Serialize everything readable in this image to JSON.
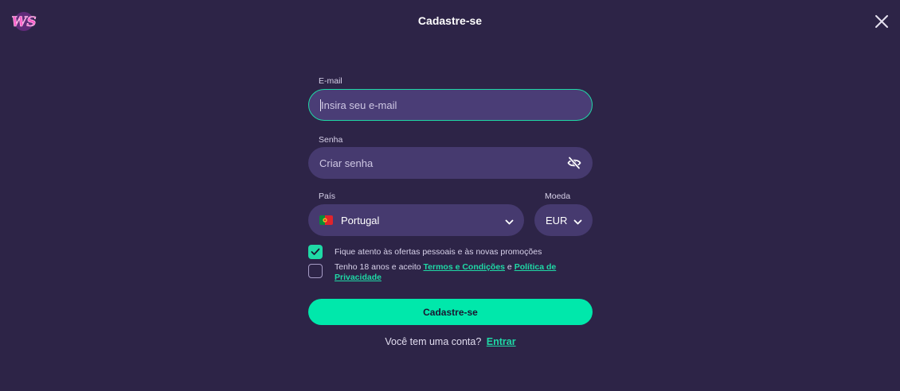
{
  "header": {
    "logo_text": "WS",
    "title": "Cadastre-se"
  },
  "form": {
    "email": {
      "label": "E-mail",
      "placeholder": "Insira seu e-mail",
      "value": ""
    },
    "password": {
      "label": "Senha",
      "placeholder": "Criar senha",
      "value": ""
    },
    "country": {
      "label": "País",
      "selected": "Portugal"
    },
    "currency": {
      "label": "Moeda",
      "selected": "EUR"
    },
    "offers": {
      "label": "Fique atento às ofertas pessoais e às novas promoções",
      "checked": true
    },
    "terms": {
      "prefix": "Tenho 18 anos e aceito ",
      "terms_link": "Termos e Condições",
      "conjunction": " e ",
      "privacy_link": "Política de Privacidade",
      "checked": false
    },
    "submit_label": "Cadastre-se"
  },
  "footer": {
    "question": "Você tem uma conta?",
    "login_link": "Entrar"
  },
  "colors": {
    "background": "#2d2447",
    "field": "#463a6f",
    "accent": "#00e8ab"
  },
  "icons": [
    "logo-icon",
    "close-icon",
    "eye-slash-icon",
    "portugal-flag-icon",
    "chevron-down-icon",
    "checkmark-icon"
  ]
}
